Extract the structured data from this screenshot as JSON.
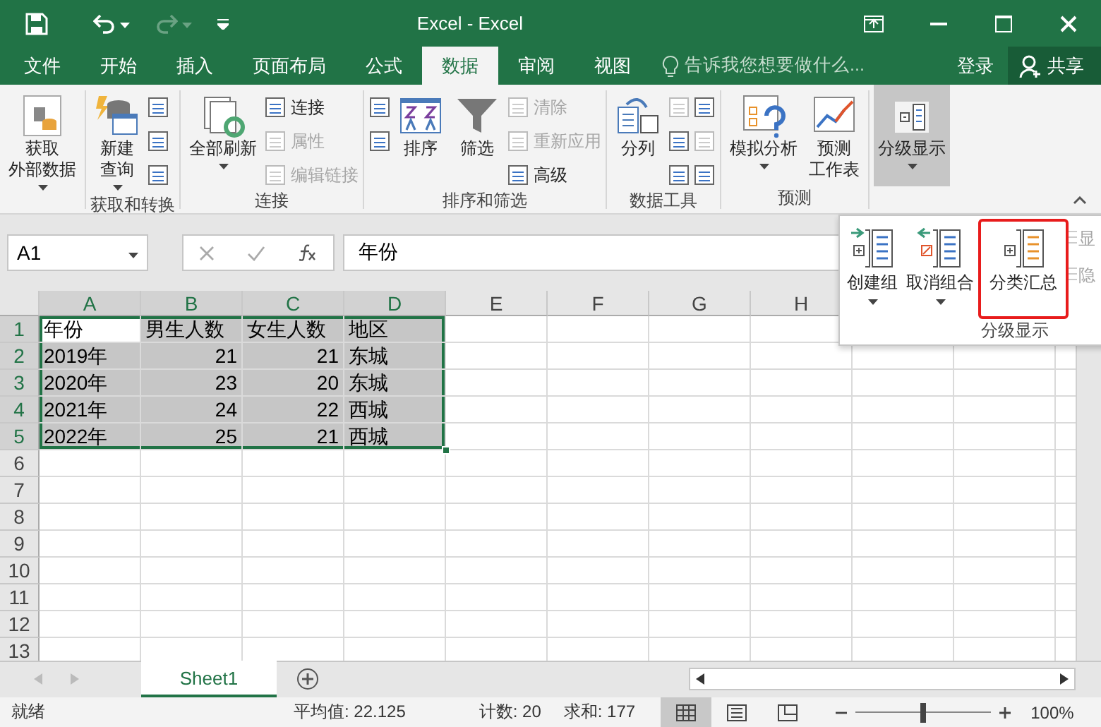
{
  "window": {
    "title": "Excel - Excel"
  },
  "tabs": [
    {
      "label": "文件",
      "selected": false
    },
    {
      "label": "开始",
      "selected": false
    },
    {
      "label": "插入",
      "selected": false
    },
    {
      "label": "页面布局",
      "selected": false
    },
    {
      "label": "公式",
      "selected": false
    },
    {
      "label": "数据",
      "selected": true
    },
    {
      "label": "审阅",
      "selected": false
    },
    {
      "label": "视图",
      "selected": false
    }
  ],
  "tell_me": {
    "placeholder": "告诉我您想要做什么..."
  },
  "sign_in": "登录",
  "share": "共享",
  "ribbon_groups": [
    {
      "items": [
        {
          "kind": "large",
          "lines": [
            "获取",
            "外部数据"
          ],
          "dropdown": true,
          "pressed": false
        }
      ]
    },
    {
      "label": "获取和转换",
      "items": [
        {
          "kind": "large",
          "lines": [
            "新建",
            "查询"
          ],
          "dropdown": true,
          "pressed": false
        },
        {
          "kind": "stack",
          "rows": [
            {
              "disabled": false
            },
            {
              "disabled": false
            },
            {
              "disabled": false
            }
          ]
        }
      ]
    },
    {
      "label": "连接",
      "items": [
        {
          "kind": "large",
          "lines": [
            "全部刷新"
          ],
          "dropdown": true,
          "pressed": false
        },
        {
          "kind": "stack",
          "rows": [
            {
              "label": "连接",
              "disabled": false
            },
            {
              "label": "属性",
              "disabled": true
            },
            {
              "label": "编辑链接",
              "disabled": true
            }
          ]
        }
      ]
    },
    {
      "label": "排序和筛选",
      "items": [
        {
          "kind": "stack",
          "rows": [
            {
              "disabled": false
            },
            {
              "disabled": false
            }
          ]
        },
        {
          "kind": "large",
          "lines": [
            "排序"
          ],
          "dropdown": false,
          "pressed": false
        },
        {
          "kind": "large",
          "lines": [
            "筛选"
          ],
          "dropdown": false,
          "pressed": false
        },
        {
          "kind": "stack",
          "rows": [
            {
              "label": "清除",
              "disabled": true
            },
            {
              "label": "重新应用",
              "disabled": true
            },
            {
              "label": "高级",
              "disabled": false
            }
          ]
        }
      ]
    },
    {
      "label": "数据工具",
      "items": [
        {
          "kind": "large",
          "lines": [
            "分列"
          ],
          "dropdown": false,
          "pressed": false
        },
        {
          "kind": "stack",
          "rows": [
            {
              "disabled": true
            },
            {
              "disabled": false
            },
            {
              "disabled": false
            }
          ]
        },
        {
          "kind": "stack",
          "rows": [
            {
              "disabled": false
            },
            {
              "disabled": true
            },
            {
              "disabled": false
            }
          ]
        }
      ]
    },
    {
      "label": "预测",
      "items": [
        {
          "kind": "large",
          "lines": [
            "模拟分析"
          ],
          "dropdown": true,
          "pressed": false
        },
        {
          "kind": "large",
          "lines": [
            "预测",
            "工作表"
          ],
          "dropdown": false,
          "pressed": false
        }
      ]
    },
    {
      "items": [
        {
          "kind": "large",
          "lines": [
            "分级显示"
          ],
          "dropdown": true,
          "pressed": true
        }
      ]
    }
  ],
  "outline_popup": {
    "label": "分级显示",
    "buttons": [
      {
        "label": "创建组",
        "dropdown": true,
        "highlighted": false
      },
      {
        "label": "取消组合",
        "dropdown": true,
        "highlighted": false
      },
      {
        "label": "分类汇总",
        "dropdown": false,
        "highlighted": true
      }
    ],
    "side": [
      {
        "label": "显",
        "disabled": true
      },
      {
        "label": "隐",
        "disabled": true
      }
    ]
  },
  "formula_bar": {
    "name_box": "A1",
    "value": "年份"
  },
  "columns": [
    "A",
    "B",
    "C",
    "D",
    "E",
    "F",
    "G",
    "H"
  ],
  "rows": [
    {
      "header": "1",
      "cells": [
        {
          "text": "年份",
          "kind": "text",
          "selected": true,
          "active": true
        },
        {
          "text": "男生人数",
          "kind": "text",
          "selected": true,
          "active": false
        },
        {
          "text": "女生人数",
          "kind": "text",
          "selected": true,
          "active": false
        },
        {
          "text": "地区",
          "kind": "text",
          "selected": true,
          "active": false
        }
      ]
    },
    {
      "header": "2",
      "cells": [
        {
          "text": "2019年",
          "kind": "text",
          "selected": true,
          "active": false
        },
        {
          "text": "21",
          "kind": "number",
          "selected": true,
          "active": false
        },
        {
          "text": "21",
          "kind": "number",
          "selected": true,
          "active": false
        },
        {
          "text": "东城",
          "kind": "text",
          "selected": true,
          "active": false
        }
      ]
    },
    {
      "header": "3",
      "cells": [
        {
          "text": "2020年",
          "kind": "text",
          "selected": true,
          "active": false
        },
        {
          "text": "23",
          "kind": "number",
          "selected": true,
          "active": false
        },
        {
          "text": "20",
          "kind": "number",
          "selected": true,
          "active": false
        },
        {
          "text": "东城",
          "kind": "text",
          "selected": true,
          "active": false
        }
      ]
    },
    {
      "header": "4",
      "cells": [
        {
          "text": "2021年",
          "kind": "text",
          "selected": true,
          "active": false
        },
        {
          "text": "24",
          "kind": "number",
          "selected": true,
          "active": false
        },
        {
          "text": "22",
          "kind": "number",
          "selected": true,
          "active": false
        },
        {
          "text": "西城",
          "kind": "text",
          "selected": true,
          "active": false
        }
      ]
    },
    {
      "header": "5",
      "cells": [
        {
          "text": "2022年",
          "kind": "text",
          "selected": true,
          "active": false
        },
        {
          "text": "25",
          "kind": "number",
          "selected": true,
          "active": false
        },
        {
          "text": "21",
          "kind": "number",
          "selected": true,
          "active": false
        },
        {
          "text": "西城",
          "kind": "text",
          "selected": true,
          "active": false
        }
      ]
    },
    {
      "header": "6",
      "cells": []
    },
    {
      "header": "7",
      "cells": []
    },
    {
      "header": "8",
      "cells": []
    },
    {
      "header": "9",
      "cells": []
    },
    {
      "header": "10",
      "cells": []
    },
    {
      "header": "11",
      "cells": []
    },
    {
      "header": "12",
      "cells": []
    },
    {
      "header": "13",
      "cells": []
    }
  ],
  "sheets": [
    {
      "label": "Sheet1",
      "selected": true
    }
  ],
  "status_bar": {
    "ready": "就绪",
    "average": "平均值: 22.125",
    "count": "计数: 20",
    "sum": "求和: 177",
    "views": [
      {
        "selected": true
      },
      {
        "selected": false
      },
      {
        "selected": false
      }
    ],
    "zoom": {
      "level": 0.5,
      "reading": "100%"
    }
  }
}
